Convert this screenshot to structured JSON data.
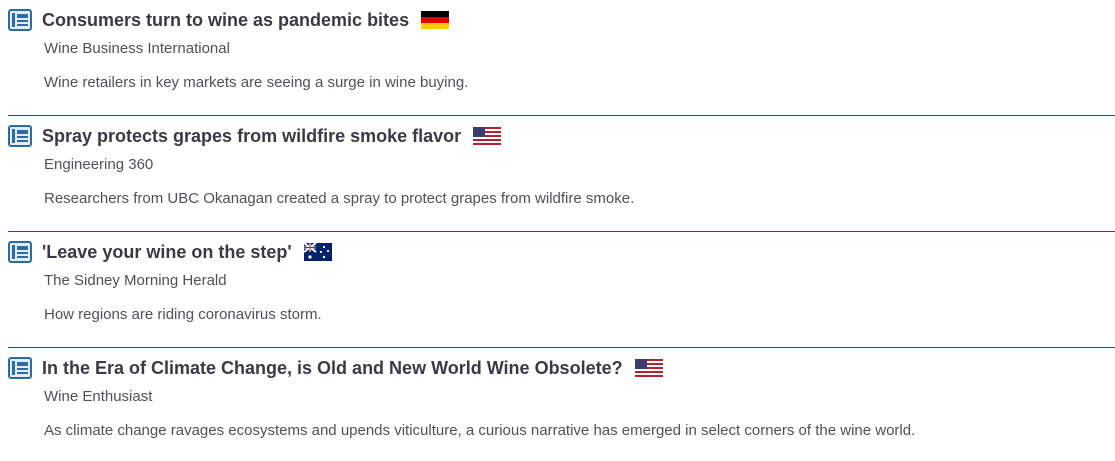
{
  "articles": [
    {
      "title": "Consumers turn to wine as pandemic bites",
      "source": "Wine Business International",
      "description": "Wine retailers in key markets are seeing a surge in wine buying.",
      "flag": "germany-flag-icon"
    },
    {
      "title": "Spray protects grapes from wildfire smoke flavor",
      "source": "Engineering 360",
      "description": "Researchers from UBC Okanagan created a spray to protect grapes from wildfire smoke.",
      "flag": "usa-flag-icon"
    },
    {
      "title": "'Leave your wine on the step'",
      "source": "The Sidney Morning Herald",
      "description": "How regions are riding coronavirus storm.",
      "flag": "australia-flag-icon"
    },
    {
      "title": "In the Era of Climate Change, is Old and New World Wine Obsolete?",
      "source": "Wine Enthusiast",
      "description": "As climate change ravages ecosystems and upends viticulture, a curious narrative has emerged in select corners of the wine world.",
      "flag": "usa-flag-icon"
    }
  ],
  "colors": {
    "title": "#3a3a44",
    "text": "#505058",
    "divider": "#8a2a40",
    "icon": "#2d6ca2"
  }
}
